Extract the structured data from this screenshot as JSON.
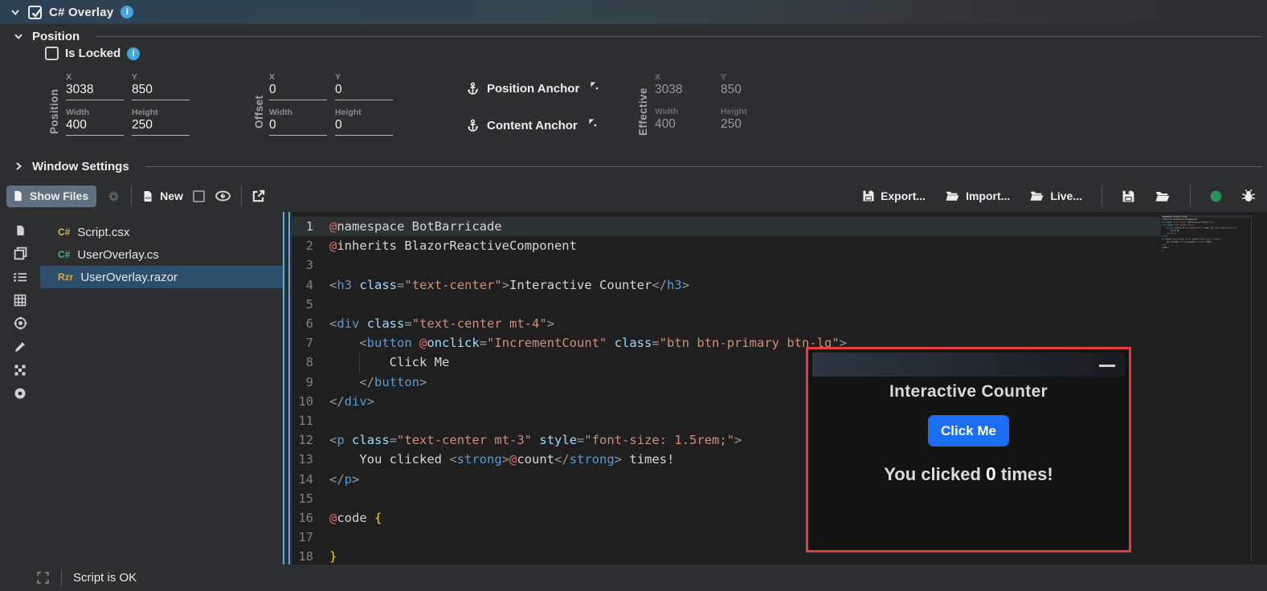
{
  "header": {
    "title": "C# Overlay",
    "checkbox_checked": true
  },
  "position_section": {
    "title": "Position",
    "is_locked_label": "Is Locked"
  },
  "groups": {
    "position": {
      "label": "Position",
      "fields": [
        {
          "label": "X",
          "value": "3038"
        },
        {
          "label": "Y",
          "value": "850"
        },
        {
          "label": "Width",
          "value": "400"
        },
        {
          "label": "Height",
          "value": "250"
        }
      ]
    },
    "offset": {
      "label": "Offset",
      "fields": [
        {
          "label": "X",
          "value": "0"
        },
        {
          "label": "Y",
          "value": "0"
        },
        {
          "label": "Width",
          "value": "0"
        },
        {
          "label": "Height",
          "value": "0"
        }
      ]
    },
    "effective": {
      "label": "Effective",
      "fields": [
        {
          "label": "X",
          "value": "3038"
        },
        {
          "label": "Y",
          "value": "850"
        },
        {
          "label": "Width",
          "value": "400"
        },
        {
          "label": "Height",
          "value": "250"
        }
      ]
    }
  },
  "anchors": {
    "position_anchor": "Position Anchor",
    "content_anchor": "Content Anchor"
  },
  "window_settings": {
    "title": "Window Settings"
  },
  "toolbar": {
    "show_files": "Show Files",
    "new": "New",
    "export": "Export...",
    "import": "Import...",
    "live": "Live..."
  },
  "icon_strip": [
    "file-icon",
    "copy-icon",
    "checklist-icon",
    "grid-icon",
    "target-icon",
    "eyedropper-icon",
    "tiles-icon",
    "record-icon"
  ],
  "files": [
    {
      "badge": "C#",
      "badge_color": "#d9b84d",
      "name": "Script.csx",
      "selected": false
    },
    {
      "badge": "C#",
      "badge_color": "#43b581",
      "name": "UserOverlay.cs",
      "selected": false
    },
    {
      "badge": "Rzr",
      "badge_color": "#e0a33e",
      "name": "UserOverlay.razor",
      "selected": true
    }
  ],
  "editor": {
    "lines": [
      {
        "active": true,
        "tokens": [
          [
            "at",
            "@"
          ],
          [
            "txt",
            "namespace BotBarricade"
          ]
        ]
      },
      {
        "tokens": [
          [
            "at",
            "@"
          ],
          [
            "txt",
            "inherits BlazorReactiveComponent"
          ]
        ]
      },
      {
        "tokens": []
      },
      {
        "tokens": [
          [
            "br",
            "<"
          ],
          [
            "tag",
            "h3"
          ],
          [
            "txt",
            " "
          ],
          [
            "attr",
            "class"
          ],
          [
            "br",
            "="
          ],
          [
            "str",
            "\"text-center\""
          ],
          [
            "br",
            ">"
          ],
          [
            "txt",
            "Interactive Counter"
          ],
          [
            "br",
            "</"
          ],
          [
            "tag",
            "h3"
          ],
          [
            "br",
            ">"
          ]
        ]
      },
      {
        "tokens": []
      },
      {
        "tokens": [
          [
            "br",
            "<"
          ],
          [
            "tag",
            "div"
          ],
          [
            "txt",
            " "
          ],
          [
            "attr",
            "class"
          ],
          [
            "br",
            "="
          ],
          [
            "str",
            "\"text-center mt-4\""
          ],
          [
            "br",
            ">"
          ]
        ]
      },
      {
        "tokens": [
          [
            "txt",
            "    "
          ],
          [
            "br",
            "<"
          ],
          [
            "tag",
            "button"
          ],
          [
            "txt",
            " "
          ],
          [
            "at",
            "@"
          ],
          [
            "attr",
            "onclick"
          ],
          [
            "br",
            "="
          ],
          [
            "str",
            "\"IncrementCount\""
          ],
          [
            "txt",
            " "
          ],
          [
            "attr",
            "class"
          ],
          [
            "br",
            "="
          ],
          [
            "str",
            "\"btn btn-primary btn-lg\""
          ],
          [
            "br",
            ">"
          ]
        ]
      },
      {
        "tokens": [
          [
            "txt",
            "        Click Me"
          ]
        ]
      },
      {
        "tokens": [
          [
            "txt",
            "    "
          ],
          [
            "br",
            "</"
          ],
          [
            "tag",
            "button"
          ],
          [
            "br",
            ">"
          ]
        ]
      },
      {
        "tokens": [
          [
            "br",
            "</"
          ],
          [
            "tag",
            "div"
          ],
          [
            "br",
            ">"
          ]
        ]
      },
      {
        "tokens": []
      },
      {
        "tokens": [
          [
            "br",
            "<"
          ],
          [
            "tag",
            "p"
          ],
          [
            "txt",
            " "
          ],
          [
            "attr",
            "class"
          ],
          [
            "br",
            "="
          ],
          [
            "str",
            "\"text-center mt-3\""
          ],
          [
            "txt",
            " "
          ],
          [
            "attr",
            "style"
          ],
          [
            "br",
            "="
          ],
          [
            "str",
            "\"font-size: 1.5rem;\""
          ],
          [
            "br",
            ">"
          ]
        ]
      },
      {
        "tokens": [
          [
            "txt",
            "    You clicked "
          ],
          [
            "br",
            "<"
          ],
          [
            "tag",
            "strong"
          ],
          [
            "br",
            ">"
          ],
          [
            "at",
            "@"
          ],
          [
            "txt",
            "count"
          ],
          [
            "br",
            "</"
          ],
          [
            "tag",
            "strong"
          ],
          [
            "br",
            ">"
          ],
          [
            "txt",
            " times!"
          ]
        ]
      },
      {
        "tokens": [
          [
            "br",
            "</"
          ],
          [
            "tag",
            "p"
          ],
          [
            "br",
            ">"
          ]
        ]
      },
      {
        "tokens": []
      },
      {
        "tokens": [
          [
            "at",
            "@"
          ],
          [
            "txt",
            "code "
          ],
          [
            "y",
            "{"
          ]
        ]
      },
      {
        "tokens": []
      },
      {
        "tokens": [
          [
            "y",
            "}"
          ]
        ]
      }
    ]
  },
  "overlay_preview": {
    "title": "Interactive Counter",
    "button": "Click Me",
    "message_prefix": "You clicked ",
    "count": "0",
    "message_suffix": " times!"
  },
  "status_bar": {
    "text": "Script is OK"
  },
  "colors": {
    "accent_blue": "#1b6ef3",
    "overlay_border_red": "#e93c3c",
    "status_green": "#2c9154",
    "selected_row_blue": "#2d4f6b",
    "header_gradient_blue": "#2b4254"
  }
}
